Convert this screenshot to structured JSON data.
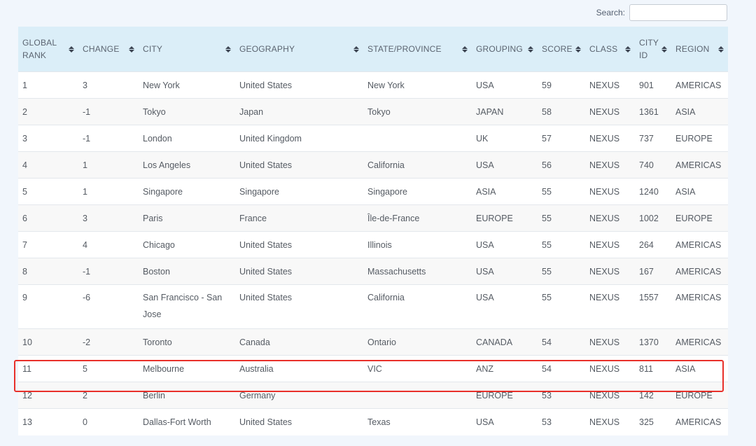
{
  "search": {
    "label": "Search:",
    "value": "",
    "placeholder": ""
  },
  "table": {
    "columns": [
      {
        "key": "rank",
        "label": "GLOBAL RANK"
      },
      {
        "key": "change",
        "label": "CHANGE"
      },
      {
        "key": "city",
        "label": "CITY"
      },
      {
        "key": "geography",
        "label": "GEOGRAPHY"
      },
      {
        "key": "state",
        "label": "STATE/PROVINCE"
      },
      {
        "key": "grouping",
        "label": "GROUPING"
      },
      {
        "key": "score",
        "label": "SCORE"
      },
      {
        "key": "class",
        "label": "CLASS"
      },
      {
        "key": "city_id",
        "label": "CITY ID"
      },
      {
        "key": "region",
        "label": "REGION"
      }
    ],
    "rows": [
      {
        "rank": "1",
        "change": "3",
        "city": "New York",
        "geography": "United States",
        "state": "New York",
        "grouping": "USA",
        "score": "59",
        "class": "NEXUS",
        "city_id": "901",
        "region": "AMERICAS"
      },
      {
        "rank": "2",
        "change": "-1",
        "city": "Tokyo",
        "geography": "Japan",
        "state": "Tokyo",
        "grouping": "JAPAN",
        "score": "58",
        "class": "NEXUS",
        "city_id": "1361",
        "region": "ASIA"
      },
      {
        "rank": "3",
        "change": "-1",
        "city": "London",
        "geography": "United Kingdom",
        "state": "",
        "grouping": "UK",
        "score": "57",
        "class": "NEXUS",
        "city_id": "737",
        "region": "EUROPE"
      },
      {
        "rank": "4",
        "change": "1",
        "city": "Los Angeles",
        "geography": "United States",
        "state": "California",
        "grouping": "USA",
        "score": "56",
        "class": "NEXUS",
        "city_id": "740",
        "region": "AMERICAS"
      },
      {
        "rank": "5",
        "change": "1",
        "city": "Singapore",
        "geography": "Singapore",
        "state": "Singapore",
        "grouping": "ASIA",
        "score": "55",
        "class": "NEXUS",
        "city_id": "1240",
        "region": "ASIA"
      },
      {
        "rank": "6",
        "change": "3",
        "city": "Paris",
        "geography": "France",
        "state": "Île-de-France",
        "grouping": "EUROPE",
        "score": "55",
        "class": "NEXUS",
        "city_id": "1002",
        "region": "EUROPE"
      },
      {
        "rank": "7",
        "change": "4",
        "city": "Chicago",
        "geography": "United States",
        "state": "Illinois",
        "grouping": "USA",
        "score": "55",
        "class": "NEXUS",
        "city_id": "264",
        "region": "AMERICAS"
      },
      {
        "rank": "8",
        "change": "-1",
        "city": "Boston",
        "geography": "United States",
        "state": "Massachusetts",
        "grouping": "USA",
        "score": "55",
        "class": "NEXUS",
        "city_id": "167",
        "region": "AMERICAS"
      },
      {
        "rank": "9",
        "change": "-6",
        "city": "San Francisco - San Jose",
        "geography": "United States",
        "state": "California",
        "grouping": "USA",
        "score": "55",
        "class": "NEXUS",
        "city_id": "1557",
        "region": "AMERICAS"
      },
      {
        "rank": "10",
        "change": "-2",
        "city": "Toronto",
        "geography": "Canada",
        "state": "Ontario",
        "grouping": "CANADA",
        "score": "54",
        "class": "NEXUS",
        "city_id": "1370",
        "region": "AMERICAS"
      },
      {
        "rank": "11",
        "change": "5",
        "city": "Melbourne",
        "geography": "Australia",
        "state": "VIC",
        "grouping": "ANZ",
        "score": "54",
        "class": "NEXUS",
        "city_id": "811",
        "region": "ASIA"
      },
      {
        "rank": "12",
        "change": "2",
        "city": "Berlin",
        "geography": "Germany",
        "state": "",
        "grouping": "EUROPE",
        "score": "53",
        "class": "NEXUS",
        "city_id": "142",
        "region": "EUROPE"
      },
      {
        "rank": "13",
        "change": "0",
        "city": "Dallas-Fort Worth",
        "geography": "United States",
        "state": "Texas",
        "grouping": "USA",
        "score": "53",
        "class": "NEXUS",
        "city_id": "325",
        "region": "AMERICAS"
      }
    ]
  },
  "colors": {
    "header_bg": "#dbeef8",
    "page_bg": "#f1f6fc",
    "highlight": "#e8302a"
  },
  "icons": {
    "sort": "sort-both-icon"
  }
}
